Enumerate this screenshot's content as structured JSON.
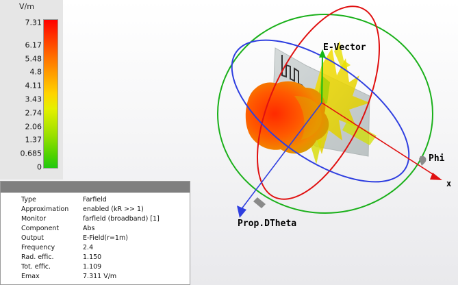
{
  "legend": {
    "unit": "V/m",
    "ticks": [
      {
        "label": "7.31",
        "value": 7.31
      },
      {
        "label": "6.17",
        "value": 6.17
      },
      {
        "label": "5.48",
        "value": 5.48
      },
      {
        "label": "4.8",
        "value": 4.8
      },
      {
        "label": "4.11",
        "value": 4.11
      },
      {
        "label": "3.43",
        "value": 3.43
      },
      {
        "label": "2.74",
        "value": 2.74
      },
      {
        "label": "2.06",
        "value": 2.06
      },
      {
        "label": "1.37",
        "value": 1.37
      },
      {
        "label": "0.685",
        "value": 0.685
      },
      {
        "label": "0",
        "value": 0
      }
    ],
    "colors": {
      "max": "#ff0000",
      "mid": "#ffd400",
      "min": "#22c810"
    }
  },
  "info": {
    "rows": [
      {
        "key": "Type",
        "value": "Farfield"
      },
      {
        "key": "Approximation",
        "value": "enabled (kR >> 1)"
      },
      {
        "key": "Monitor",
        "value": "farfield (broadband) [1]"
      },
      {
        "key": "Component",
        "value": "Abs"
      },
      {
        "key": "Output",
        "value": "E-Field(r=1m)"
      },
      {
        "key": "Frequency",
        "value": "2.4"
      },
      {
        "key": "Rad. effic.",
        "value": "1.150"
      },
      {
        "key": "Tot. effic.",
        "value": "1.109"
      },
      {
        "key": "Emax",
        "value": "7.311 V/m"
      }
    ]
  },
  "view": {
    "labels": {
      "e_vector": "E-Vector",
      "phi": "Phi",
      "x_axis": "x",
      "prop_theta": "Prop.DTheta"
    },
    "colors": {
      "theta_circle": "#e01010",
      "phi_circle": "#2f3fe0",
      "outer_circle": "#1ab01a",
      "e_vector_arrow": "#14b814",
      "x_axis_arrow": "#e01010",
      "prop_arrow": "#2f3fe0"
    }
  }
}
